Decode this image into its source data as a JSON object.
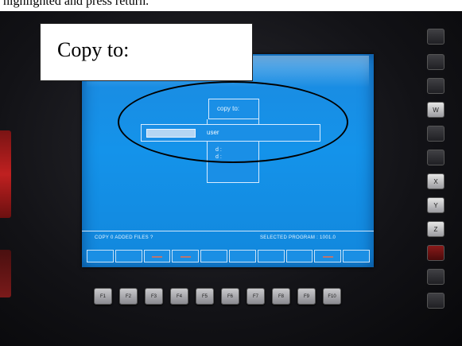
{
  "page_strip": {
    "text": "highlighted and press return."
  },
  "callout": {
    "label": "Copy to:"
  },
  "screen": {
    "dialog_title": "copy to:",
    "input_text": "user",
    "options": [
      "d :",
      "d :"
    ],
    "status_left": "COPY 0 ADDED FILES ?",
    "status_right": "SELECTED PROGRAM : 1001.0",
    "softkey_count": 10
  },
  "fkeys": [
    "F1",
    "F2",
    "F3",
    "F4",
    "F5",
    "F6",
    "F7",
    "F8",
    "F9",
    "F10"
  ],
  "right_keys": [
    "",
    "",
    "",
    "W",
    "",
    "",
    "X",
    "Y",
    "Z",
    "",
    "",
    ""
  ],
  "colors": {
    "screen_bg": "#1493ea",
    "annotation": "#000000"
  }
}
